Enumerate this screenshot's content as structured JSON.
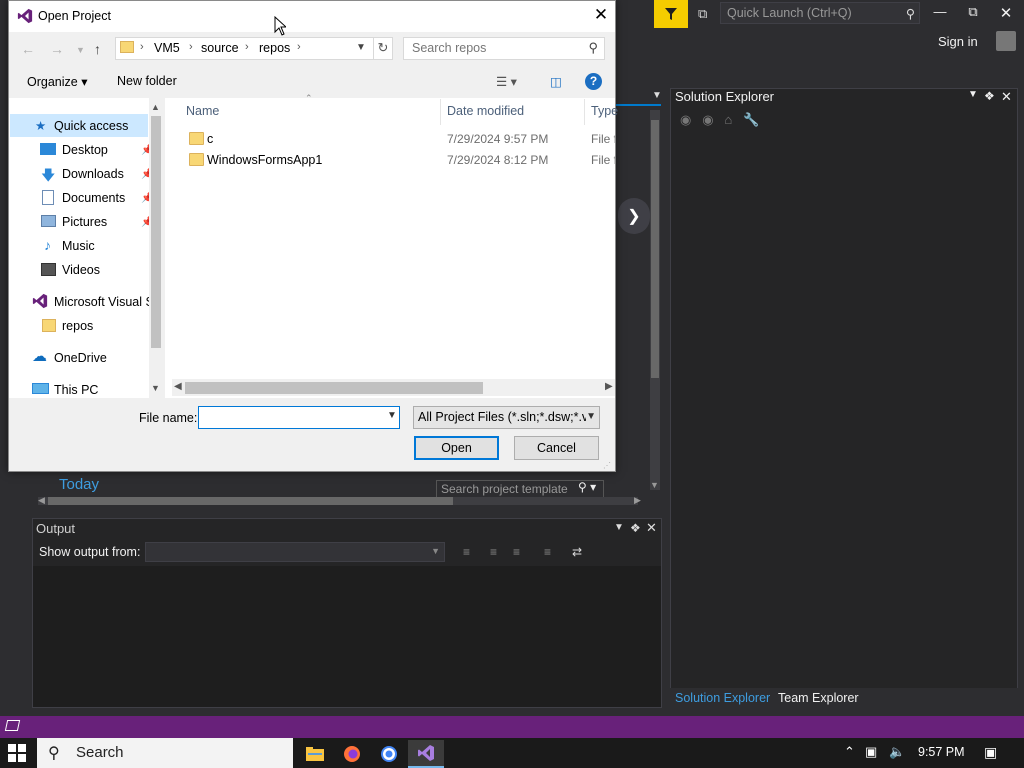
{
  "dialog": {
    "title": "Open Project",
    "breadcrumb": [
      "VM5",
      "source",
      "repos"
    ],
    "search_placeholder": "Search repos",
    "organize_label": "Organize ▾",
    "new_folder_label": "New folder",
    "nav_items": {
      "quick_access": "Quick access",
      "desktop": "Desktop",
      "downloads": "Downloads",
      "documents": "Documents",
      "pictures": "Pictures",
      "music": "Music",
      "videos": "Videos",
      "microsoft_vs": "Microsoft Visual S",
      "repos": "repos",
      "onedrive": "OneDrive",
      "this_pc": "This PC"
    },
    "columns": {
      "name": "Name",
      "date": "Date modified",
      "type": "Type"
    },
    "files": [
      {
        "name": "c",
        "date": "7/29/2024 9:57 PM",
        "type": "File fo"
      },
      {
        "name": "WindowsFormsApp1",
        "date": "7/29/2024 8:12 PM",
        "type": "File fo"
      }
    ],
    "file_name_label": "File name:",
    "file_name_value": "",
    "filter_value": "All Project Files (*.sln;*.dsw;*.vc",
    "open_label": "Open",
    "cancel_label": "Cancel"
  },
  "vs": {
    "quick_launch_placeholder": "Quick Launch (Ctrl+Q)",
    "sign_in": "Sign in",
    "solution_explorer_title": "Solution Explorer",
    "today_label": "Today",
    "search_templates_placeholder": "Search project template",
    "output_title": "Output",
    "show_output_from": "Show output from:",
    "tab_solution_explorer": "Solution Explorer",
    "tab_team_explorer": "Team Explorer"
  },
  "taskbar": {
    "search_label": "Search",
    "clock": "9:57 PM"
  },
  "colors": {
    "accent": "#007acc",
    "status_bar": "#68217a",
    "selection": "#cce8ff"
  }
}
